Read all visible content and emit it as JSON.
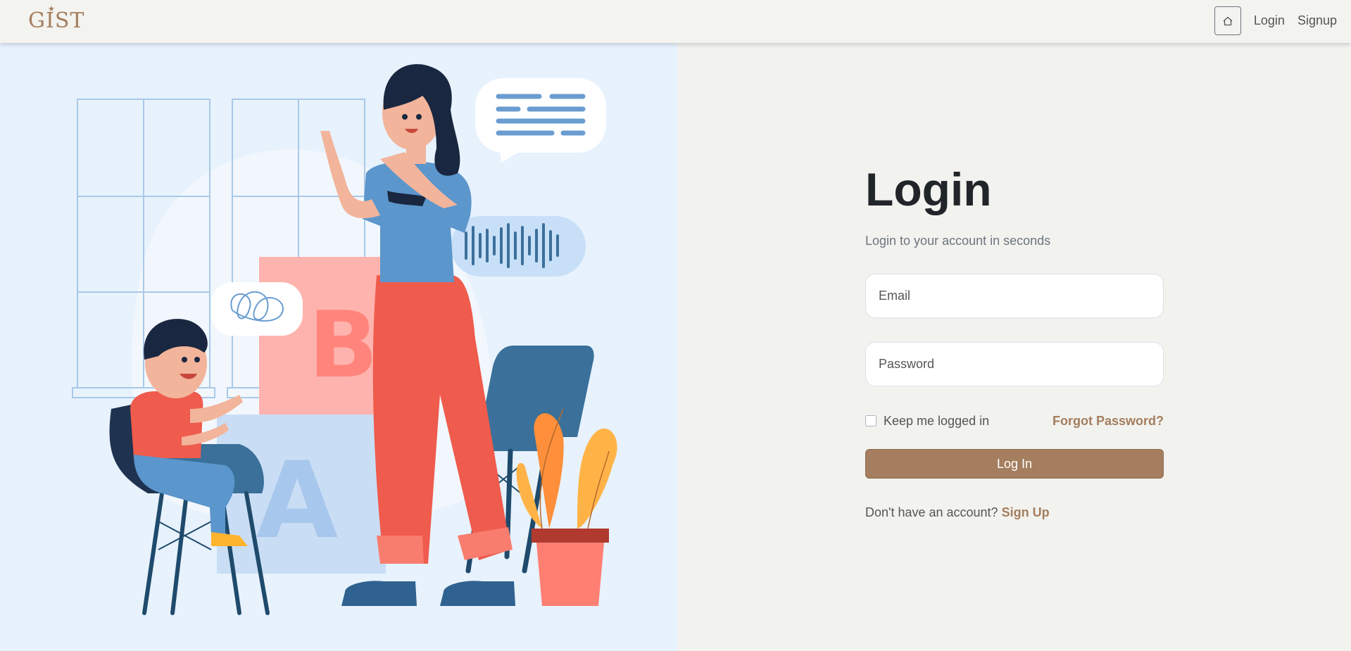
{
  "brand": {
    "name": "GIST"
  },
  "nav": {
    "home_icon": "home-icon",
    "links": [
      "Login",
      "Signup"
    ]
  },
  "login": {
    "title": "Login",
    "subtitle": "Login to your account in seconds",
    "email_placeholder": "Email",
    "password_placeholder": "Password",
    "keep_logged_in": "Keep me logged in",
    "forgot_password": "Forgot Password?",
    "submit": "Log In",
    "no_account": "Don't have an account?",
    "signup": "Sign Up"
  },
  "illustration": {
    "letters": [
      "B",
      "A"
    ]
  },
  "colors": {
    "accent": "#a47e5e",
    "nav_bg": "#f3f3f0",
    "page_bg": "#f2f2ef",
    "illustration_bg": "#e7f2fd"
  }
}
